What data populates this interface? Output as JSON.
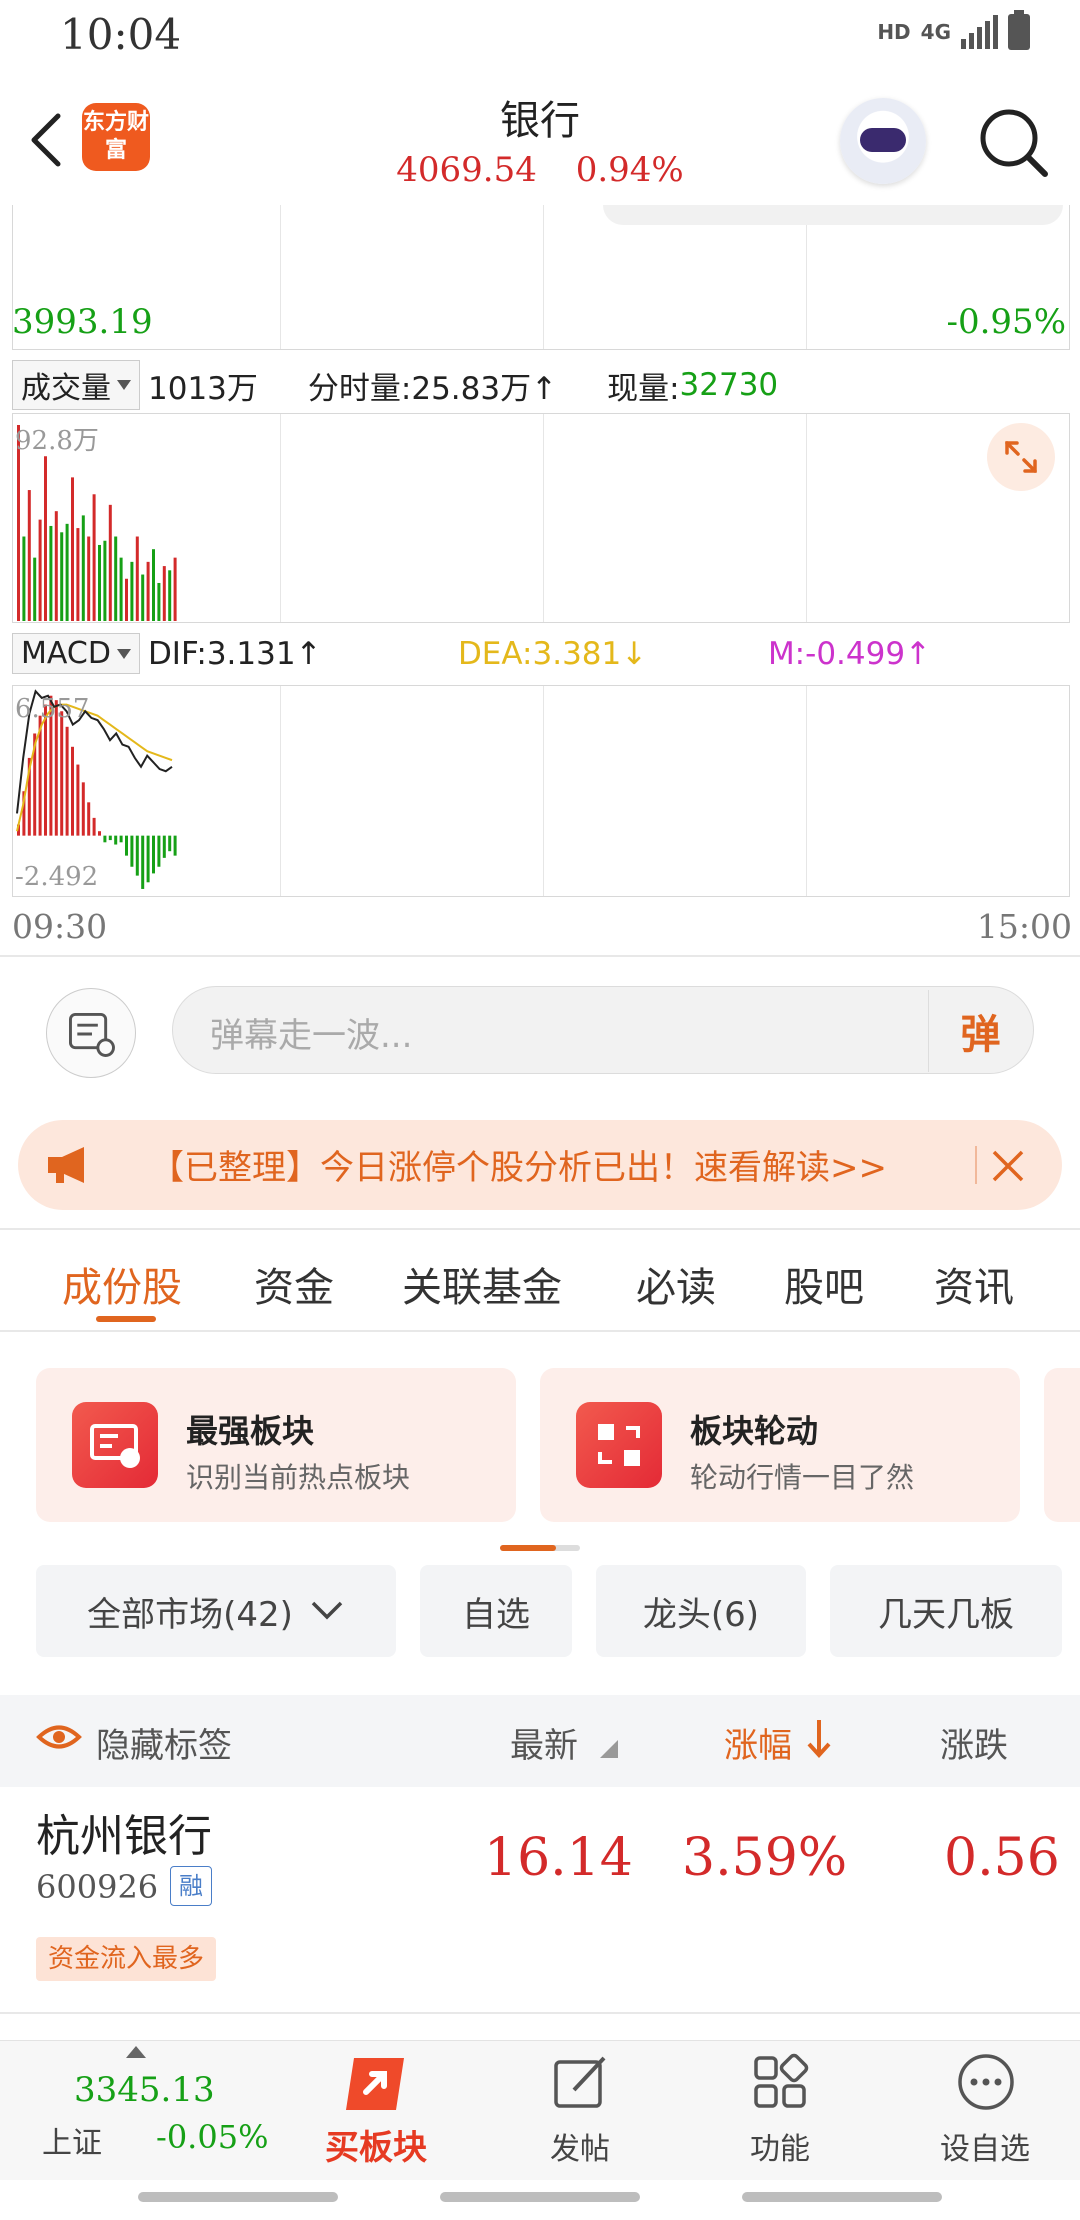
{
  "status_bar": {
    "time": "10:04",
    "network": "HD",
    "signal": "4G"
  },
  "header": {
    "logo": "东方财富",
    "title": "银行",
    "price": "4069.54",
    "change_pct": "0.94%"
  },
  "price_chart": {
    "low_price": "3993.19",
    "low_pct": "-0.95%"
  },
  "volume": {
    "selector": "成交量",
    "total": "1013万",
    "intraday_label": "分时量:25.83万↑",
    "current_label": "现量:",
    "current_value": "32730",
    "max_label": "92.8万",
    "bars": [
      {
        "v": 92.8,
        "c": "r"
      },
      {
        "v": 40,
        "c": "g"
      },
      {
        "v": 62,
        "c": "r"
      },
      {
        "v": 30,
        "c": "g"
      },
      {
        "v": 48,
        "c": "r"
      },
      {
        "v": 78,
        "c": "r"
      },
      {
        "v": 45,
        "c": "g"
      },
      {
        "v": 52,
        "c": "r"
      },
      {
        "v": 42,
        "c": "g"
      },
      {
        "v": 46,
        "c": "g"
      },
      {
        "v": 68,
        "c": "r"
      },
      {
        "v": 44,
        "c": "r"
      },
      {
        "v": 50,
        "c": "g"
      },
      {
        "v": 40,
        "c": "r"
      },
      {
        "v": 60,
        "c": "r"
      },
      {
        "v": 36,
        "c": "g"
      },
      {
        "v": 38,
        "c": "g"
      },
      {
        "v": 55,
        "c": "r"
      },
      {
        "v": 40,
        "c": "g"
      },
      {
        "v": 30,
        "c": "g"
      },
      {
        "v": 20,
        "c": "r"
      },
      {
        "v": 28,
        "c": "g"
      },
      {
        "v": 40,
        "c": "r"
      },
      {
        "v": 22,
        "c": "g"
      },
      {
        "v": 28,
        "c": "r"
      },
      {
        "v": 34,
        "c": "g"
      },
      {
        "v": 18,
        "c": "g"
      },
      {
        "v": 26,
        "c": "r"
      },
      {
        "v": 24,
        "c": "g"
      },
      {
        "v": 30,
        "c": "r"
      }
    ]
  },
  "macd": {
    "selector": "MACD",
    "dif": "DIF:3.131↑",
    "dea": "DEA:3.381↓",
    "m": "M:-0.499↑",
    "max_label": "6.557",
    "min_label": "-2.492",
    "ymax": 6.557,
    "ymin": -2.492,
    "hist": [
      0.5,
      2.0,
      3.5,
      4.6,
      5.4,
      5.9,
      6.3,
      6.1,
      5.6,
      4.9,
      4.0,
      3.2,
      2.4,
      1.5,
      0.8,
      0.2,
      -0.3,
      -0.2,
      -0.4,
      -0.3,
      -0.9,
      -1.4,
      -1.8,
      -2.4,
      -2.1,
      -1.7,
      -1.4,
      -1.0,
      -0.7,
      -0.9
    ],
    "dif_line": [
      1.0,
      3.5,
      5.5,
      6.5,
      6.2,
      6.3,
      5.8,
      5.9,
      5.6,
      5.0,
      5.2,
      5.6,
      5.3,
      5.2,
      4.8,
      4.3,
      4.6,
      4.1,
      4.0,
      3.5,
      3.1,
      3.6,
      3.3,
      3.0,
      2.9,
      3.1
    ],
    "dea_line": [
      0.2,
      1.4,
      3.0,
      4.2,
      5.0,
      5.5,
      5.8,
      5.9,
      5.9,
      5.8,
      5.7,
      5.6,
      5.5,
      5.4,
      5.2,
      5.0,
      4.8,
      4.6,
      4.4,
      4.2,
      4.0,
      3.8,
      3.7,
      3.6,
      3.5,
      3.4
    ]
  },
  "time_axis": {
    "start": "09:30",
    "end": "15:00"
  },
  "comment": {
    "placeholder": "弹幕走一波...",
    "send_label": "弹"
  },
  "notice": {
    "text": "【已整理】今日涨停个股分析已出！速看解读>>"
  },
  "tabs": [
    "成份股",
    "资金",
    "关联基金",
    "必读",
    "股吧",
    "资讯"
  ],
  "cards": [
    {
      "title": "最强板块",
      "subtitle": "识别当前热点板块"
    },
    {
      "title": "板块轮动",
      "subtitle": "轮动行情一目了然"
    }
  ],
  "filters": [
    "全部市场(42)",
    "自选",
    "龙头(6)",
    "几天几板"
  ],
  "table": {
    "hide_tags": "隐藏标签",
    "col_latest": "最新",
    "col_pct": "涨幅",
    "col_change": "涨跌",
    "rows": [
      {
        "name": "杭州银行",
        "code": "600926",
        "badge": "融",
        "tag": "资金流入最多",
        "latest": "16.14",
        "pct": "3.59%",
        "change": "0.56"
      }
    ]
  },
  "bottom_nav": {
    "index_value": "3345.13",
    "index_name": "上证",
    "index_change": "-0.05%",
    "buy_label": "买板块",
    "post_label": "发帖",
    "func_label": "功能",
    "watch_label": "设自选"
  },
  "colors": {
    "up": "#d32a2a",
    "down": "#16a016",
    "accent": "#e0651f"
  }
}
